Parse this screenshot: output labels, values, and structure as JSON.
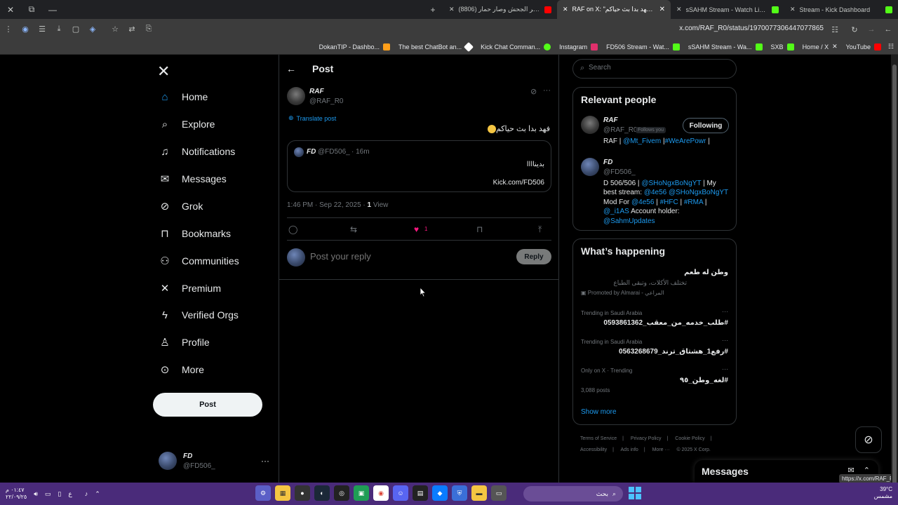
{
  "browser": {
    "tabs": [
      {
        "title": "(8806) كبر الجحش وصار حمار :(..",
        "favicon_color": "#ff0000",
        "active": false
      },
      {
        "title": "RAF on X: \"فهد بدا بث حياكم 🤫",
        "favicon_color": "#ffffff",
        "active": true
      },
      {
        "title": "sSAHM Stream - Watch Live on",
        "favicon_color": "#53fc18",
        "active": false
      },
      {
        "title": "Stream - Kick Dashboard",
        "favicon_color": "#53fc18",
        "active": false
      }
    ],
    "url": "x.com/RAF_R0/status/1970077306447077865",
    "bookmarks": [
      {
        "label": "DokanTIP - Dashbo...",
        "color": "#ff9f1a"
      },
      {
        "label": "The best ChatBot an...",
        "color": "#ffffff"
      },
      {
        "label": "Kick Chat Comman...",
        "color": "#53fc18"
      },
      {
        "label": "Instagram",
        "color": "#e1306c"
      },
      {
        "label": "FD506 Stream - Wat...",
        "color": "#53fc18"
      },
      {
        "label": "sSAHM Stream - Wa...",
        "color": "#53fc18"
      },
      {
        "label": "SXB",
        "color": "#53fc18"
      },
      {
        "label": "Home / X",
        "color": "#ffffff"
      },
      {
        "label": "YouTube",
        "color": "#ff0000"
      }
    ],
    "status_url": "https://x.com/RAF_R0"
  },
  "nav": {
    "logo": "X",
    "items": [
      {
        "label": "Home",
        "icon": "home-icon",
        "glyph": "⌂"
      },
      {
        "label": "Explore",
        "icon": "search-icon",
        "glyph": "⌕"
      },
      {
        "label": "Notifications",
        "icon": "bell-icon",
        "glyph": "♫"
      },
      {
        "label": "Messages",
        "icon": "envelope-icon",
        "glyph": "✉"
      },
      {
        "label": "Grok",
        "icon": "grok-icon",
        "glyph": "⊘"
      },
      {
        "label": "Bookmarks",
        "icon": "bookmark-icon",
        "glyph": "⊓"
      },
      {
        "label": "Communities",
        "icon": "people-icon",
        "glyph": "⚇"
      },
      {
        "label": "Premium",
        "icon": "x-icon",
        "glyph": "✕"
      },
      {
        "label": "Verified Orgs",
        "icon": "lightning-icon",
        "glyph": "ϟ"
      },
      {
        "label": "Profile",
        "icon": "person-icon",
        "glyph": "♙"
      },
      {
        "label": "More",
        "icon": "more-circle-icon",
        "glyph": "⊙"
      }
    ],
    "post_label": "Post",
    "account": {
      "name": "FD",
      "handle": "@FD506_"
    }
  },
  "main": {
    "title": "Post",
    "author": {
      "name": "RAF",
      "handle": "@RAF_R0"
    },
    "translate_label": "Translate post",
    "text": "فهد بدا بث حياكم",
    "quote": {
      "name": "FD",
      "handle": "@FD506_",
      "time": "· 16m",
      "line1": "بديناااا",
      "line2": "Kick.com/FD506"
    },
    "timestamp": "1:46 PM · Sep 22, 2025 · ",
    "views_count": "1",
    "views_label": " View",
    "like_count": "1",
    "reply_placeholder": "Post your reply",
    "reply_button": "Reply"
  },
  "sidebar": {
    "search_placeholder": "Search",
    "relevant_title": "Relevant people",
    "people": [
      {
        "name": "RAF",
        "handle": "@RAF_R0",
        "follows_you": "Follows you",
        "button": "Following",
        "bio_parts": [
          "RAF | ",
          "@Mt_Fivem",
          " |",
          "#WeArePowr",
          " |"
        ]
      },
      {
        "name": "FD",
        "handle": "@FD506_",
        "bio_lines": [
          [
            "D 506/506 | ",
            "@SHoNgxBoNgYT",
            " | My"
          ],
          [
            "best stream: ",
            "@4e56 @SHoNgxBoNgYT",
            ""
          ],
          [
            "Mod For ",
            "@4e56",
            " | ",
            "#HFC",
            " | ",
            "#RMA",
            " |"
          ],
          [
            "",
            "@_i1AS",
            " Account holder:"
          ],
          [
            "",
            "@SahmUpdates",
            ""
          ]
        ]
      }
    ],
    "happening_title": "What’s happening",
    "promo": {
      "title": "وطن له طعم",
      "subtitle": "تختلف الأكلات، وتبقى الطباع",
      "promoted": "Promoted by Almarai - المراعي"
    },
    "trends": [
      {
        "context": "Trending in Saudi Arabia",
        "title": "#طلب_خدمه_من_معقب_0593861362",
        "count": ""
      },
      {
        "context": "Trending in Saudi Arabia",
        "title": "#رفع1_هشتاق_ترند_0563268679",
        "count": ""
      },
      {
        "context": "Only on X · Trending",
        "title": "#لغه_وطن_٩٥",
        "count": "3,088 posts"
      }
    ],
    "show_more": "Show more",
    "footer": [
      "Terms of Service",
      "|",
      "Privacy Policy",
      "|",
      "Cookie Policy",
      "|",
      "Accessibility",
      "|",
      "Ads info",
      "|",
      "More ···",
      "© 2025 X Corp."
    ]
  },
  "messages_label": "Messages",
  "taskbar": {
    "time": "٠١:٤٧ م",
    "date": "٢٢/٠٩/٢٥",
    "lang": "ع",
    "search_placeholder": "بحث",
    "weather_temp": "39°C",
    "weather_desc": "مشمس"
  }
}
